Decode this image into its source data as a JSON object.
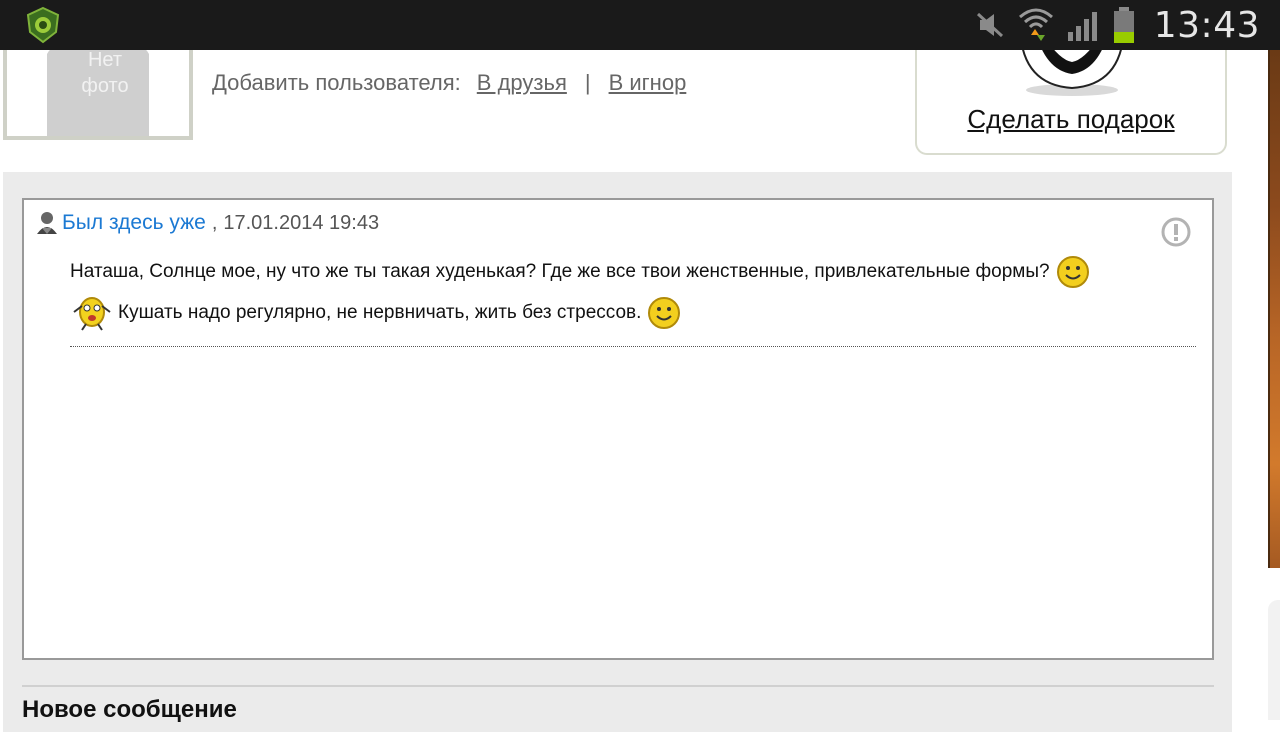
{
  "status_bar": {
    "time": "13:43",
    "icons": [
      "app-shield-icon",
      "mute-icon",
      "wifi-icon",
      "signal-icon",
      "battery-icon"
    ],
    "battery_color": "#99cc00"
  },
  "profile": {
    "avatar_text_line1": "Нет",
    "avatar_text_line2": "фото",
    "add_user_label": "Добавить пользователя:",
    "friends_link": "В друзья",
    "separator": "|",
    "ignore_link": "В игнор"
  },
  "gift": {
    "link_label": "Сделать подарок"
  },
  "message": {
    "author": "Был здесь уже",
    "comma": ",",
    "date": "17.01.2014 19:43",
    "line1": "Наташа, Солнце мое, ну что же ты такая худенькая? Где же все твои женственные, привлекательные формы?",
    "line2": "Кушать надо регулярно, не нервничать, жить без стрессов."
  },
  "new_message": {
    "heading": "Новое сообщение"
  },
  "colors": {
    "link_blue": "#1b79d3",
    "content_gray": "#ebebeb",
    "statusbar": "#1a1a1a"
  }
}
